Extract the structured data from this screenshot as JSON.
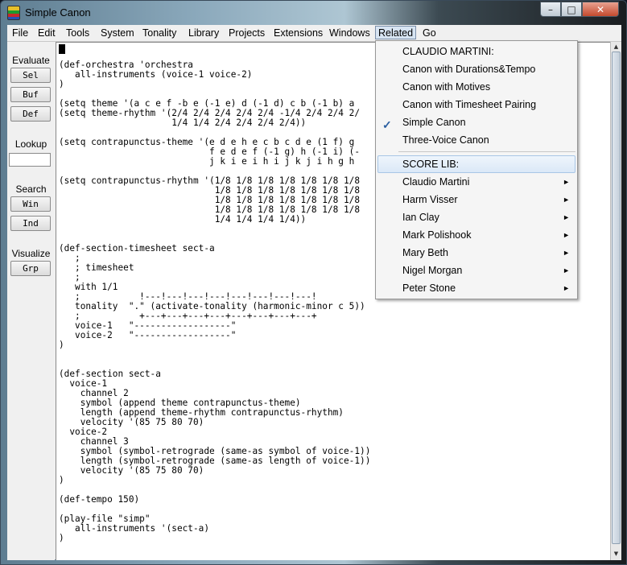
{
  "window": {
    "title": "Simple Canon",
    "minimize": "–",
    "maximize": "□",
    "close": "✕"
  },
  "menubar": [
    "File",
    "Edit",
    "Tools",
    "System",
    "Tonality",
    "Library",
    "Projects",
    "Extensions",
    "Windows",
    "Related",
    "Go"
  ],
  "side": {
    "evaluate_label": "Evaluate",
    "sel": "Sel",
    "buf": "Buf",
    "def": "Def",
    "lookup_label": "Lookup",
    "lookup_value": "",
    "search_label": "Search",
    "win": "Win",
    "ind": "Ind",
    "visualize_label": "Visualize",
    "grp": "Grp"
  },
  "code": "(def-orchestra 'orchestra\n   all-instruments (voice-1 voice-2)\n)\n\n(setq theme '(a c e f -b e (-1 e) d (-1 d) c b (-1 b) a\n(setq theme-rhythm '(2/4 2/4 2/4 2/4 2/4 -1/4 2/4 2/4 2/\n                     1/4 1/4 2/4 2/4 2/4 2/4))\n\n(setq contrapunctus-theme '(e d e h e c b c d e (1 f) g\n                            f e d e f (-1 g) h (-1 i) (-\n                            j k i e i h i j k j i h g h\n\n(setq contrapunctus-rhythm '(1/8 1/8 1/8 1/8 1/8 1/8 1/8\n                             1/8 1/8 1/8 1/8 1/8 1/8 1/8\n                             1/8 1/8 1/8 1/8 1/8 1/8 1/8\n                             1/8 1/8 1/8 1/8 1/8 1/8 1/8\n                             1/4 1/4 1/4 1/4))\n\n\n(def-section-timesheet sect-a\n   ;\n   ; timesheet\n   ;\n   with 1/1\n   ;           !---!---!---!---!---!---!---!---!\n   tonality  \".\" (activate-tonality (harmonic-minor c 5))\n   ;           +---+---+---+---+---+---+---+---+\n   voice-1   \"------------------\"\n   voice-2   \"------------------\"\n)\n\n\n(def-section sect-a\n  voice-1\n    channel 2\n    symbol (append theme contrapunctus-theme)\n    length (append theme-rhythm contrapunctus-rhythm)\n    velocity '(85 75 80 70)\n  voice-2\n    channel 3\n    symbol (symbol-retrograde (same-as symbol of voice-1))\n    length (symbol-retrograde (same-as length of voice-1))\n    velocity '(85 75 80 70)\n)\n\n(def-tempo 150)\n\n(play-file \"simp\"\n   all-instruments '(sect-a)\n)",
  "dropdown": {
    "header1": "CLAUDIO MARTINI:",
    "items1": [
      "Canon with Durations&Tempo",
      "Canon with Motives",
      "Canon with Timesheet Pairing",
      "Simple Canon",
      "Three-Voice Canon"
    ],
    "checked": "Simple Canon",
    "header2": "SCORE LIB:",
    "items2": [
      "Claudio Martini",
      "Harm Visser",
      "Ian Clay",
      "Mark Polishook",
      "Mary Beth",
      "Nigel Morgan",
      "Peter Stone"
    ]
  }
}
